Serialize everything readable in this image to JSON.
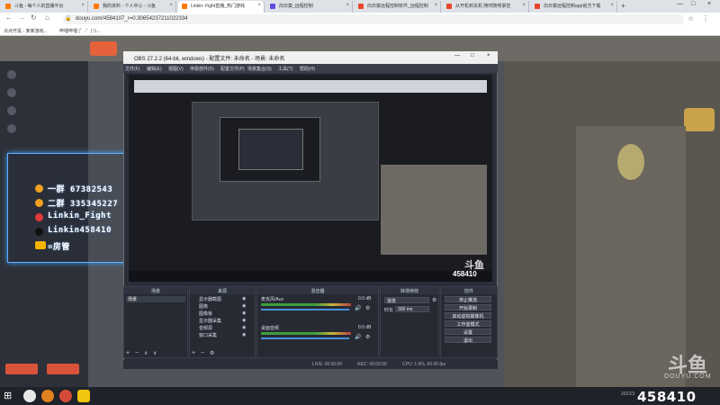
{
  "browser": {
    "tabs": [
      {
        "label": "斗鱼 - 每个人的直播平台",
        "color": "#ff7a00"
      },
      {
        "label": "我的资料 - 个人中心 - 斗鱼",
        "color": "#ff7a00"
      },
      {
        "label": "Linkin- Fight直播_热门游戏",
        "color": "#ff7a00"
      },
      {
        "label": "向日葵_远程控制",
        "color": "#5a4fe0"
      },
      {
        "label": "向日葵远程控制软件_远程控制",
        "color": "#e8452a"
      },
      {
        "label": "从开机到关机 随时随地掌控",
        "color": "#e8452a"
      },
      {
        "label": "向日葵远程控制app官方下载",
        "color": "#e8452a"
      }
    ],
    "url": "douyu.com/4584107_r=0.30654237211022334",
    "bookmarks": [
      "点点开黑 - 某某游戏...",
      "哔哩哔哩 (゜-゜)つ..."
    ]
  },
  "obs": {
    "title": "OBS 27.2.2 (64-bit, windows) - 配置文件: 未命名 - 场景: 未命名",
    "menu": [
      "文件(F)",
      "编辑(E)",
      "视图(V)",
      "停靠部件(D)",
      "配置文件(P)",
      "场景集合(S)",
      "工具(T)",
      "帮助(H)"
    ],
    "docks": {
      "scenes_title": "场景",
      "scene_item": "场景",
      "sources_title": "来源",
      "sources": [
        "显示器截图",
        "图像",
        "图像板",
        "显示器采集",
        "音频源",
        "窗口采集"
      ],
      "mixer_title": "混音器",
      "mixer_tracks": [
        {
          "name": "麦克风/Aux",
          "level": "0.0 dB"
        },
        {
          "name": "桌面音频",
          "level": "0.0 dB"
        }
      ],
      "transitions_title": "转场特效",
      "transition_value": "渐变",
      "duration_label": "时长",
      "duration_value": "300 ms",
      "controls_title": "控件",
      "controls": [
        "停止推流",
        "开始录制",
        "启动虚拟摄像机",
        "工作室模式",
        "设置",
        "退出"
      ]
    },
    "status": {
      "live": "LIVE: 00:00:00",
      "rec": "REC: 00:00:00",
      "cpu": "CPU: 1.9%, 60.00 fps"
    }
  },
  "overlay": {
    "lines": [
      {
        "text": "一群 67382543",
        "icon_color": "#f0a020"
      },
      {
        "text": "二群 335345227",
        "icon_color": "#f0a020"
      },
      {
        "text": "Linkin_Fight",
        "icon_color": "#e03a3a"
      },
      {
        "text": "Linkin458410",
        "icon_color": "#222222"
      },
      {
        "text": "=房管",
        "icon_color": "#f4b400"
      }
    ]
  },
  "stream": {
    "room_number": "458410",
    "watermark": "斗鱼",
    "watermark_sub": "DOUYU.COM"
  },
  "taskbar": {
    "clock": "2022/3"
  }
}
